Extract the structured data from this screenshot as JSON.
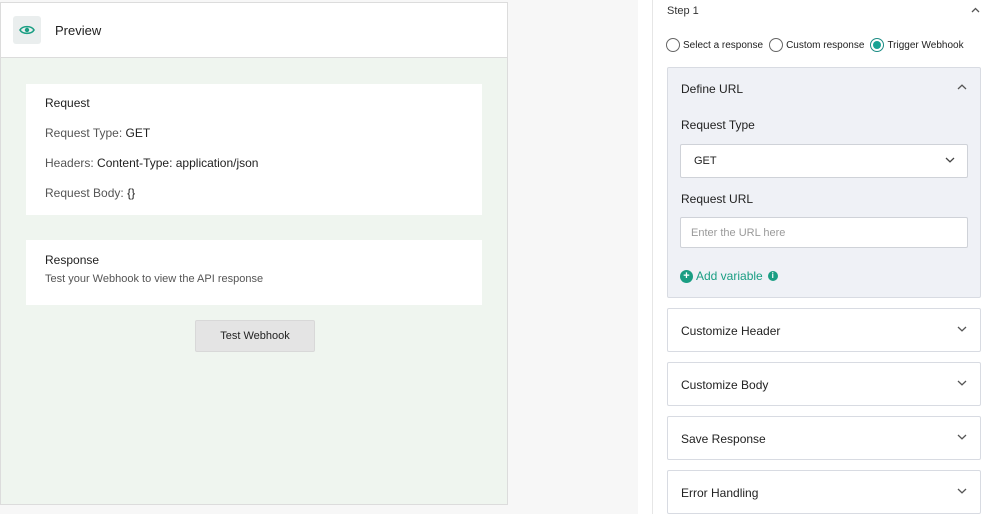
{
  "preview": {
    "title": "Preview",
    "request": {
      "title": "Request",
      "type_label": "Request Type:",
      "type_value": "GET",
      "headers_label": "Headers:",
      "headers_value": "Content-Type: application/json",
      "body_label": "Request Body:",
      "body_value": "{}"
    },
    "response": {
      "title": "Response",
      "subtitle": "Test your Webhook to view the API response"
    },
    "test_button": "Test Webhook"
  },
  "step": {
    "label": "Step 1",
    "options": [
      "Select a response",
      "Custom response",
      "Trigger Webhook"
    ],
    "selected": "Trigger Webhook"
  },
  "define_url": {
    "title": "Define URL",
    "request_type_label": "Request Type",
    "request_type_value": "GET",
    "request_url_label": "Request URL",
    "request_url_placeholder": "Enter the URL here",
    "request_url_value": "",
    "add_variable": "Add variable"
  },
  "sections": [
    "Customize Header",
    "Customize Body",
    "Save Response",
    "Error Handling"
  ],
  "colors": {
    "accent": "#1a9e83",
    "preview_bg": "#eff5ef",
    "define_bg": "#eff1f6"
  }
}
